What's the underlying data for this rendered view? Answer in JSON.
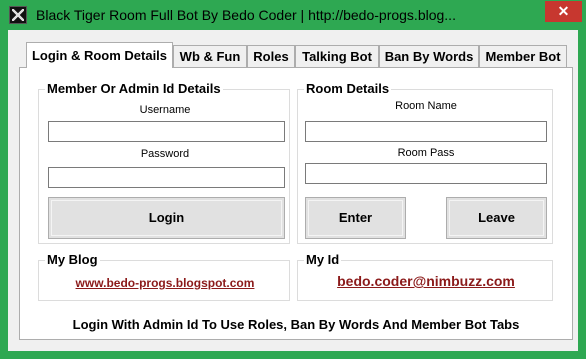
{
  "window": {
    "title": "Black Tiger Room Full Bot By Bedo Coder | http://bedo-progs.blog...",
    "close_glyph": "✕",
    "icon": "tiger-app-icon"
  },
  "tabs": [
    {
      "label": "Login & Room Details",
      "active": true
    },
    {
      "label": "Wb & Fun",
      "active": false
    },
    {
      "label": "Roles",
      "active": false
    },
    {
      "label": "Talking Bot",
      "active": false
    },
    {
      "label": "Ban By Words",
      "active": false
    },
    {
      "label": "Member Bot",
      "active": false
    }
  ],
  "member_group": {
    "title": "Member Or Admin Id Details",
    "username_label": "Username",
    "username_value": "",
    "password_label": "Password",
    "password_value": "",
    "login_button": "Login"
  },
  "room_group": {
    "title": "Room Details",
    "room_name_label": "Room Name",
    "room_name_value": "",
    "room_pass_label": "Room Pass",
    "room_pass_value": "",
    "enter_button": "Enter",
    "leave_button": "Leave"
  },
  "blog_group": {
    "title": "My Blog",
    "link": "www.bedo-progs.blogspot.com"
  },
  "id_group": {
    "title": "My Id",
    "link": "bedo.coder@nimbuzz.com"
  },
  "footer_note": "Login With Admin Id To Use Roles, Ban By Words And Member Bot Tabs",
  "colors": {
    "window_frame": "#2ea852",
    "close_button": "#c7372f",
    "link": "#8b1a1a"
  }
}
